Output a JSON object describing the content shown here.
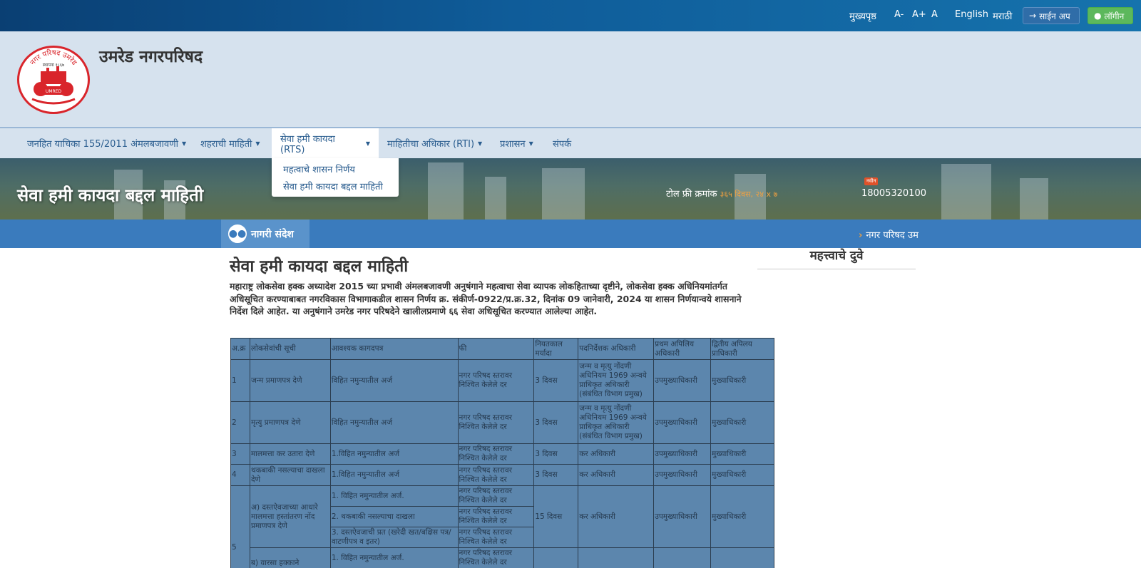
{
  "topbar": {
    "home": "मुख्यपृष्ठ",
    "font_decrease": "A-",
    "font_increase": "A+",
    "font_reset": "A",
    "lang_english": "English",
    "lang_marathi": "मराठी",
    "signup": "साईन अप",
    "login": "लॉगीन"
  },
  "header": {
    "site_title": "उमरेड नगरपरिषद",
    "logo_text_top": "नगर परिषद उमरेड",
    "logo_text_est": "स्थापना १८६७",
    "logo_text_bottom": "UMRED"
  },
  "nav": {
    "items": [
      {
        "label": "जनहित याचिका 155/2011 अंमलबजावणी"
      },
      {
        "label": "शहराची माहिती"
      },
      {
        "label": "सेवा हमी कायदा (RTS)"
      },
      {
        "label": "माहितीचा अधिकार (RTI)"
      },
      {
        "label": "प्रशासन"
      },
      {
        "label": "संपर्क"
      }
    ],
    "dropdown": [
      {
        "label": "महत्वाचे शासन निर्णय"
      },
      {
        "label": "सेवा हमी कायदा बद्दल माहिती"
      }
    ]
  },
  "banner": {
    "page_heading": "सेवा हमी कायदा बद्दल माहिती",
    "tollfree_label": "टोल फ्री क्रमांक",
    "tollfree_hours": "३६५ दिवस, २४ x ७",
    "tollfree_number": "18005320100",
    "new_badge": "नवीन"
  },
  "news": {
    "button_label": "नागरी संदेश",
    "ticker_text": "नगर परिषद उम"
  },
  "content": {
    "title": "सेवा हमी कायदा बद्दल माहिती",
    "intro": "महाराष्ट्र लोकसेवा हक्क अध्यादेश 2015 च्या प्रभावी अंमलबजावणी अनुषंगाने महत्वाचा सेवा व्यापक लोकहिताच्या दृष्टीने, लोकसेवा हक्क अधिनियमांतर्गत अधिसूचित करण्याबाबत नगरविकास विभागाकडील शासन निर्णय क्र. संकीर्ण-0922/प्र.क्र.32, दिनांक 09 जानेवारी, 2024 या शासन निर्णयान्वये शासनाने निर्देश दिले आहेत. या अनुषंगाने उमरेड  नगर परिषदेने  खालीलप्रमाणे ६६ सेवा अधिसूचित करण्यात आलेल्या आहेत.",
    "sidebar_title": "महत्त्वाचे दुवे"
  },
  "table": {
    "headers": [
      "अ.क्र",
      "लोकसेवांची सूची",
      "आवश्यक कागदपत्र",
      "फी",
      "नियतकाल मर्यादा",
      "पदनिर्देशक अधिकारी",
      "प्रथम अपिलिय अधिकारी",
      "द्वितीय अपिलय प्राधिकारी"
    ],
    "rows": [
      {
        "no": "1",
        "service": "जन्म प्रमाणपत्र देणे",
        "docs": "विहित नमुन्यातील अर्ज",
        "fee": "नगर परिषद  स्तरावर निश्चित केलेले दर",
        "time": "3 दिवस",
        "officer": "जन्म व मृत्यु नोंदणी अधिनियम 1969 अन्वये प्राधिकृत अधिकारी (संबंधित विभाग प्रमुख)",
        "appeal1": "उपमुख्याधिकारी",
        "appeal2": "मुख्याधिकारी"
      },
      {
        "no": "2",
        "service": "मृत्यु प्रमाणपत्र देणे",
        "docs": "विहित नमुन्यातील अर्ज",
        "fee": "नगर परिषद  स्तरावर निश्चित केलेले दर",
        "time": "3 दिवस",
        "officer": "जन्म व मृत्यु नोंदणी अधिनियम 1969 अन्वये प्राधिकृत अधिकारी (संबंधित विभाग प्रमुख)",
        "appeal1": "उपमुख्याधिकारी",
        "appeal2": "मुख्याधिकारी"
      },
      {
        "no": "3",
        "service": "मालमत्ता कर उतारा देणे",
        "docs": "1.विहित नमुन्यातील अर्ज",
        "fee": "नगर परिषद  स्तरावर निश्चित केलेले दर",
        "time": "3 दिवस",
        "officer": "कर अधिकारी",
        "appeal1": "उपमुख्याधिकारी",
        "appeal2": "मुख्याधिकारी"
      },
      {
        "no": "4",
        "service": "थकबाकी नसल्याचा दाखला देणे",
        "docs": "1.विहित नमुन्यातील अर्ज",
        "fee": "नगर परिषद  स्तरावर निश्चित केलेले दर",
        "time": "3 दिवस",
        "officer": "कर अधिकारी",
        "appeal1": "उपमुख्याधिकारी",
        "appeal2": "मुख्याधिकारी"
      }
    ],
    "row5": {
      "no": "5",
      "service_a": "अ) दस्तऐवजाच्या आधारे मालमत्ता हस्तांतरण नोंद प्रमाणपत्र देणे",
      "service_b": "ब) वारसा हक्काने",
      "docs": [
        "1. विहित नमुन्यातील अर्ज.",
        "2. थकबाकी नसल्याचा दाखला",
        "3. दस्तऐवजाची प्रत (खरेदी खत/बक्षिस पत्र/ वाटणीपत्र व इतर)",
        "1. विहित नमुन्यातील अर्ज."
      ],
      "fee": "नगर परिषद  स्तरावर निश्चित केलेले दर",
      "time": "15 दिवस",
      "officer": "कर अधिकारी",
      "appeal1": "उपमुख्याधिकारी",
      "appeal2": "मुख्याधिकारी"
    }
  },
  "colors": {
    "topbar": "#0f5c99",
    "header_bg": "#d6e2ee",
    "newsbar": "#3a7bbd",
    "table_cell": "#5c86ad",
    "login_green": "#5cb85c",
    "logo_red": "#d9252b"
  }
}
